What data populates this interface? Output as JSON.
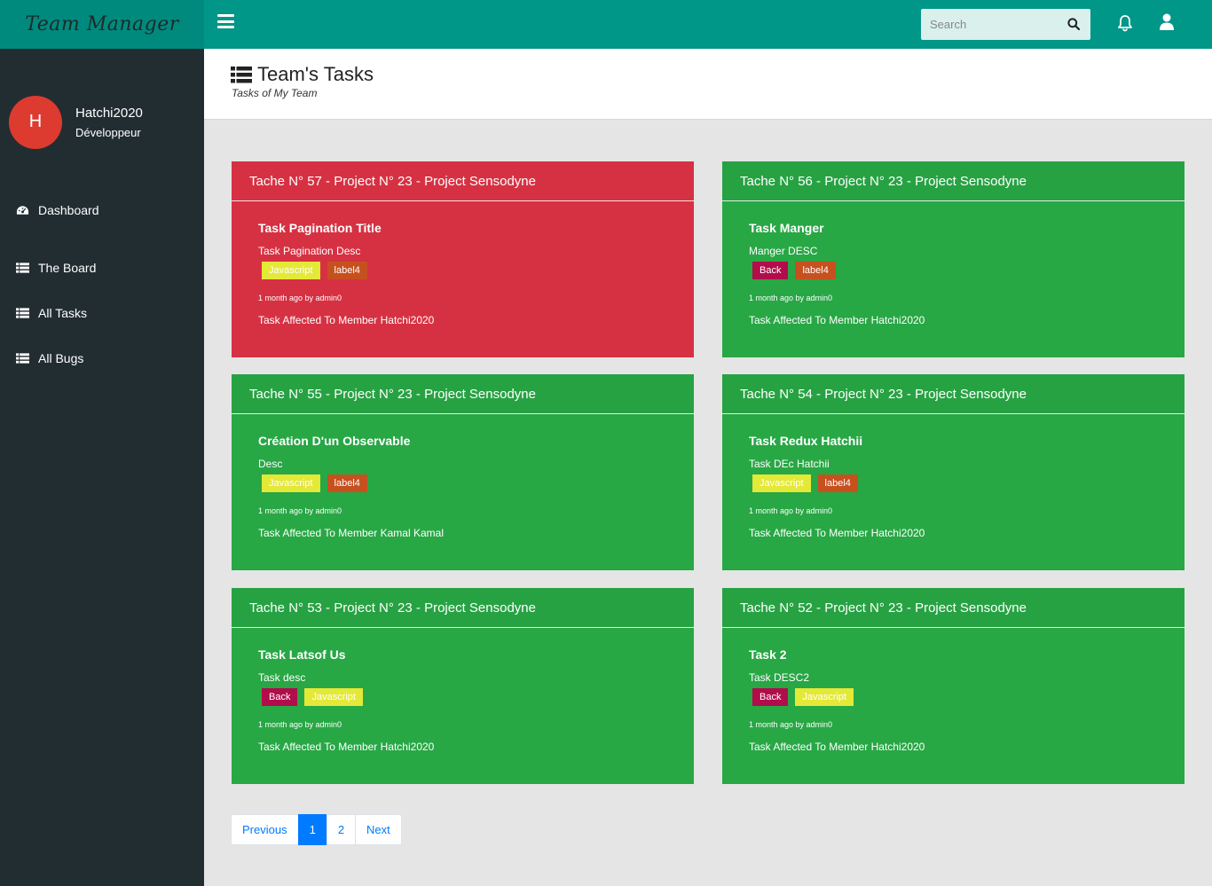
{
  "brand": {
    "title": "Team Manager",
    "bg_color": "#008a7d"
  },
  "user": {
    "initial": "H",
    "name": "Hatchi2020",
    "role": "Développeur",
    "avatar_color": "#dd3b2f"
  },
  "sidebar": {
    "items": [
      {
        "label": "Dashboard",
        "icon": "dashboard-icon"
      },
      {
        "label": "The Board",
        "icon": "list-icon"
      },
      {
        "label": "All Tasks",
        "icon": "list-icon"
      },
      {
        "label": "All Bugs",
        "icon": "list-icon"
      }
    ]
  },
  "topbar": {
    "search_placeholder": "Search",
    "bg_color": "#009688"
  },
  "header": {
    "title": "Team's Tasks",
    "subtitle": "Tasks of My Team"
  },
  "label_colors": {
    "Javascript": "#e4e837",
    "label4": "#c7501f",
    "Back": "#b20c4b"
  },
  "tasks": [
    {
      "header": "Tache N° 57 - Project N° 23 - Project Sensodyne",
      "title": "Task Pagination Title",
      "desc": "Task Pagination Desc",
      "labels": [
        "Javascript",
        "label4"
      ],
      "meta": "1 month ago by  admin0",
      "affected": "Task Affected To Member Hatchi2020",
      "status": "red"
    },
    {
      "header": "Tache N° 56 - Project N° 23 - Project Sensodyne",
      "title": "Task Manger",
      "desc": "Manger DESC",
      "labels": [
        "Back",
        "label4"
      ],
      "meta": "1 month ago by  admin0",
      "affected": "Task Affected To Member Hatchi2020",
      "status": "green"
    },
    {
      "header": "Tache N° 55 - Project N° 23 - Project Sensodyne",
      "title": "Création D'un Observable",
      "desc": "Desc",
      "labels": [
        "Javascript",
        "label4"
      ],
      "meta": "1 month ago by  admin0",
      "affected": "Task Affected To Member Kamal Kamal",
      "status": "green"
    },
    {
      "header": "Tache N° 54 - Project N° 23 - Project Sensodyne",
      "title": "Task Redux Hatchii",
      "desc": "Task DEc Hatchii",
      "labels": [
        "Javascript",
        "label4"
      ],
      "meta": "1 month ago by  admin0",
      "affected": "Task Affected To Member Hatchi2020",
      "status": "green"
    },
    {
      "header": "Tache N° 53 - Project N° 23 - Project Sensodyne",
      "title": "Task Latsof Us",
      "desc": "Task desc",
      "labels": [
        "Back",
        "Javascript"
      ],
      "meta": "1 month ago by  admin0",
      "affected": "Task Affected To Member Hatchi2020",
      "status": "green"
    },
    {
      "header": "Tache N° 52 - Project N° 23 - Project Sensodyne",
      "title": "Task 2",
      "desc": "Task DESC2",
      "labels": [
        "Back",
        "Javascript"
      ],
      "meta": "1 month ago by  admin0",
      "affected": "Task Affected To Member Hatchi2020",
      "status": "green"
    }
  ],
  "pagination": {
    "previous": "Previous",
    "pages": [
      "1",
      "2"
    ],
    "current": "1",
    "next": "Next"
  }
}
